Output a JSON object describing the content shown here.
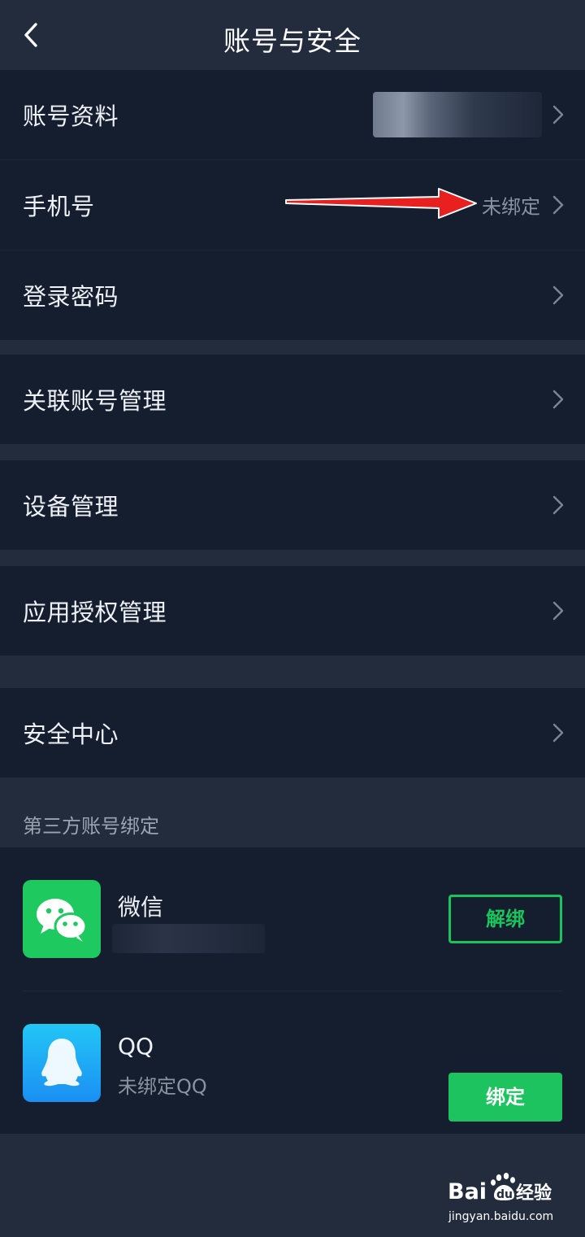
{
  "header": {
    "title": "账号与安全",
    "back_icon": "chevron-left-icon"
  },
  "group1": {
    "rows": [
      {
        "label": "账号资料",
        "value": ""
      },
      {
        "label": "手机号",
        "value": "未绑定"
      },
      {
        "label": "登录密码",
        "value": ""
      }
    ]
  },
  "group2": {
    "rows": [
      {
        "label": "关联账号管理"
      }
    ]
  },
  "group3": {
    "rows": [
      {
        "label": "设备管理"
      }
    ]
  },
  "group4": {
    "rows": [
      {
        "label": "应用授权管理"
      }
    ]
  },
  "group5": {
    "rows": [
      {
        "label": "安全中心"
      }
    ]
  },
  "third_party": {
    "caption": "第三方账号绑定",
    "wechat": {
      "name": "微信",
      "button": "解绑",
      "icon": "wechat-icon"
    },
    "qq": {
      "name": "QQ",
      "status": "未绑定QQ",
      "button": "绑定",
      "icon": "qq-penguin-icon"
    }
  },
  "watermark": {
    "logo": "Bai du 经验",
    "url": "jingyan.baidu.com"
  },
  "colors": {
    "background": "#222c3c",
    "card": "#151e2f",
    "accent_green": "#1dc35e",
    "annotation_red": "#e8201f"
  }
}
